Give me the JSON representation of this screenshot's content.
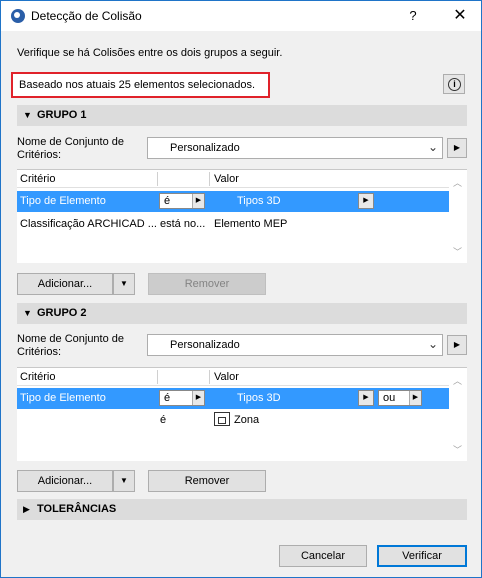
{
  "window": {
    "title": "Detecção de Colisão",
    "help": "?",
    "close": "✕"
  },
  "intro": "Verifique se há Colisões entre os dois grupos a seguir.",
  "basis": "Baseado nos atuais 25 elementos selecionados.",
  "info_glyph": "i",
  "group1": {
    "title": "GRUPO 1",
    "criteria_label_line1": "Nome de Conjunto de",
    "criteria_label_line2": "Critérios:",
    "criteria_value": "Personalizado",
    "col_criterion": "Critério",
    "col_value": "Valor",
    "rows": [
      {
        "criterion": "Tipo de Elemento",
        "operator": "é",
        "value": "Tipos 3D"
      },
      {
        "criterion": "Classificação ARCHICAD ...",
        "operator": "está no...",
        "value": "Elemento MEP"
      }
    ],
    "add_label": "Adicionar...",
    "remove_label": "Remover"
  },
  "group2": {
    "title": "GRUPO 2",
    "criteria_label_line1": "Nome de Conjunto de",
    "criteria_label_line2": "Critérios:",
    "criteria_value": "Personalizado",
    "col_criterion": "Critério",
    "col_value": "Valor",
    "rows": [
      {
        "criterion": "Tipo de Elemento",
        "operator": "é",
        "value": "Tipos 3D",
        "logic": "ou"
      },
      {
        "criterion": "",
        "operator": "é",
        "value": "Zona"
      }
    ],
    "add_label": "Adicionar...",
    "remove_label": "Remover"
  },
  "tolerances": {
    "title": "TOLERÂNCIAS"
  },
  "footer": {
    "cancel": "Cancelar",
    "verify": "Verificar"
  }
}
